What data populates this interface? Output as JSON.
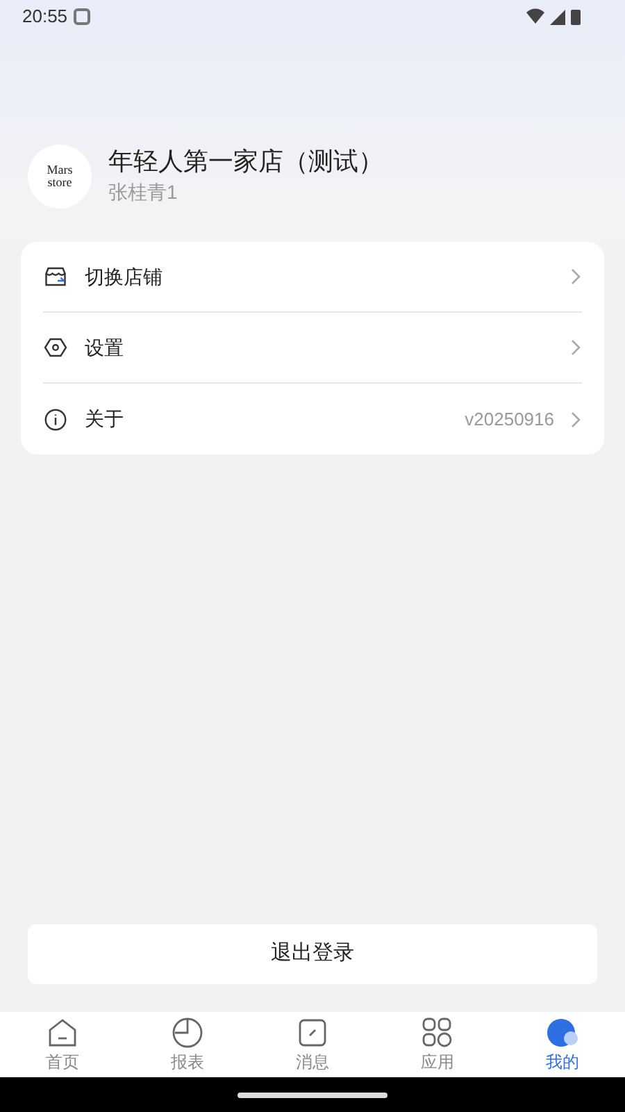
{
  "status_bar": {
    "time": "20:55"
  },
  "profile": {
    "logo_lines": [
      "Mars",
      "store"
    ],
    "store_name": "年轻人第一家店（测试）",
    "user_name": "张桂青1"
  },
  "menu": [
    {
      "kind": "store",
      "label": "切换店铺"
    },
    {
      "kind": "settings",
      "label": "设置"
    },
    {
      "kind": "info",
      "label": "关于",
      "value": "v20250916"
    }
  ],
  "logout_button": "退出登录",
  "tabs": [
    {
      "kind": "home",
      "label": "首页",
      "selected": false
    },
    {
      "kind": "report",
      "label": "报表",
      "selected": false
    },
    {
      "kind": "message",
      "label": "消息",
      "selected": false
    },
    {
      "kind": "apps",
      "label": "应用",
      "selected": false
    },
    {
      "kind": "me",
      "label": "我的",
      "selected": true
    }
  ]
}
